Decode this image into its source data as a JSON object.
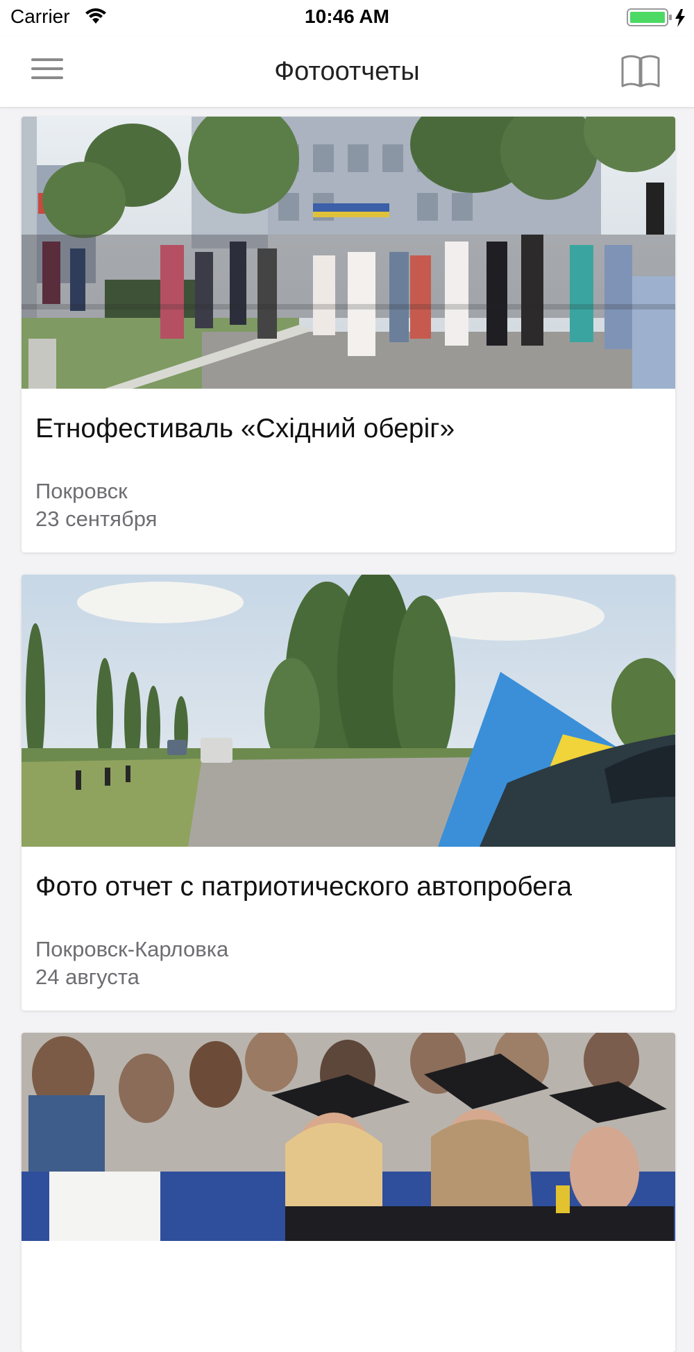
{
  "status_bar": {
    "carrier": "Carrier",
    "time": "10:46 AM"
  },
  "nav": {
    "title": "Фотоотчеты",
    "menu_icon": "hamburger-menu-icon",
    "book_icon": "open-book-icon"
  },
  "feed": {
    "items": [
      {
        "title": "Етнофестиваль «Східний оберіг»",
        "location": "Покровск",
        "date": "23 сентября",
        "photo": "crowd at outdoor festival in front of building"
      },
      {
        "title": "Фото отчет с патриотического автопробега",
        "location": "Покровск-Карловка",
        "date": "24 августа",
        "photo": "road with poplar trees and Ukrainian flag on car"
      },
      {
        "title": "",
        "location": "",
        "date": "",
        "photo": "graduates in academic caps in auditorium"
      }
    ]
  },
  "colors": {
    "background": "#f3f3f5",
    "card": "#ffffff",
    "meta_text": "#6d6d72",
    "battery": "#4cd964"
  }
}
